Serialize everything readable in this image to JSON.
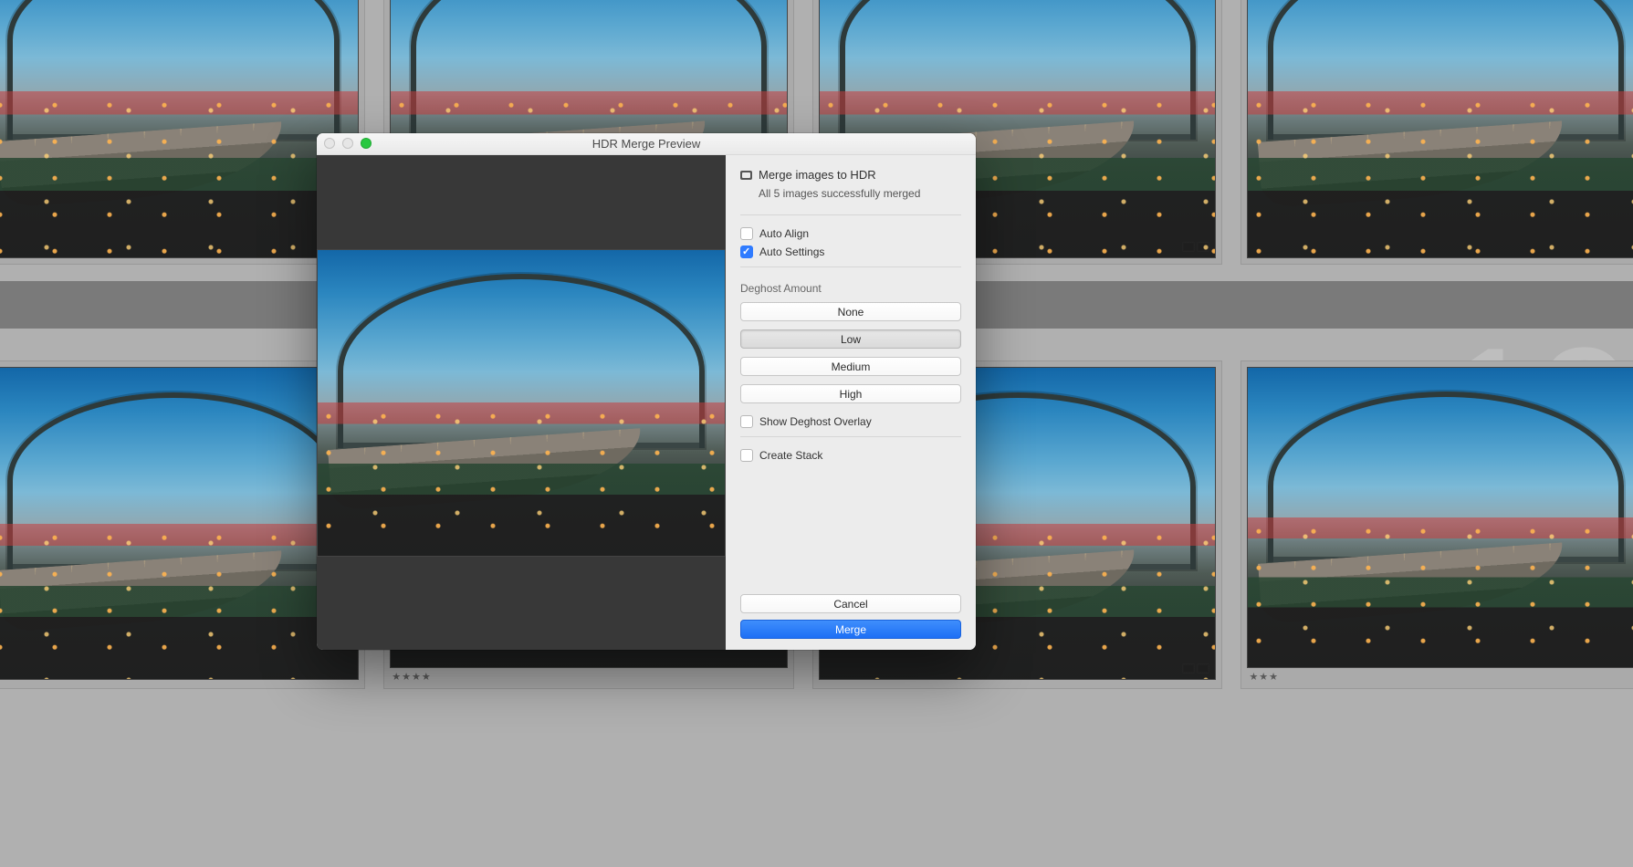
{
  "background": {
    "stack_number": "10",
    "thumbs": {
      "top_ratings": [
        "",
        "",
        "",
        ""
      ],
      "bottom_ratings": [
        "",
        "★★★★",
        "",
        "★★★"
      ]
    }
  },
  "dialog": {
    "title": "HDR Merge Preview",
    "header": {
      "title": "Merge images to HDR",
      "subtitle": "All 5 images successfully merged"
    },
    "options": {
      "auto_align": {
        "label": "Auto Align",
        "checked": false
      },
      "auto_settings": {
        "label": "Auto Settings",
        "checked": true
      }
    },
    "deghost": {
      "section_label": "Deghost Amount",
      "buttons": {
        "none": "None",
        "low": "Low",
        "medium": "Medium",
        "high": "High"
      },
      "selected": "low",
      "show_overlay": {
        "label": "Show Deghost Overlay",
        "checked": false
      }
    },
    "create_stack": {
      "label": "Create Stack",
      "checked": false
    },
    "footer": {
      "cancel": "Cancel",
      "merge": "Merge"
    }
  }
}
